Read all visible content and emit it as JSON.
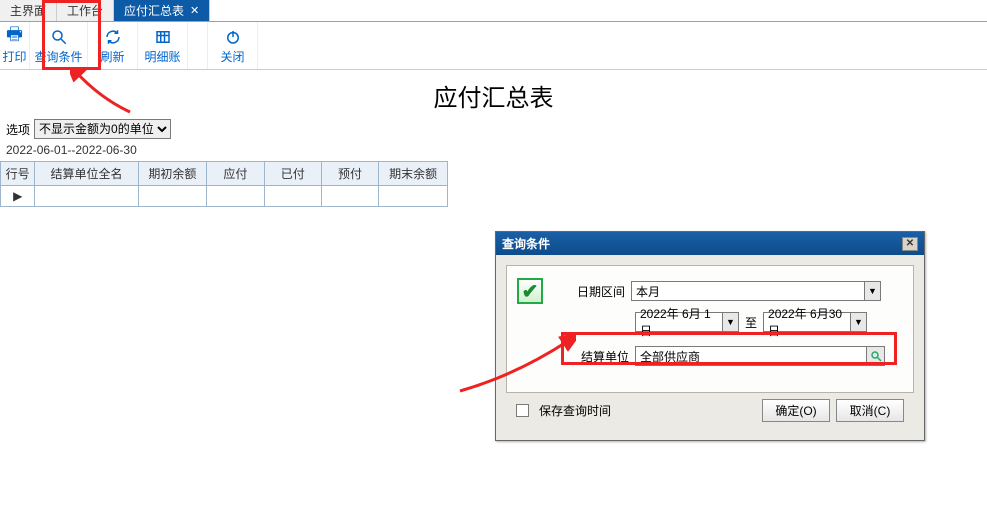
{
  "tabs": {
    "items": [
      {
        "label": "主界面"
      },
      {
        "label": "工作台"
      },
      {
        "label": "应付汇总表",
        "active": true
      }
    ]
  },
  "toolbar": {
    "print": "打印",
    "query": "查询条件",
    "refresh": "刷新",
    "detail": "明细账",
    "close": "关闭"
  },
  "page_title": "应付汇总表",
  "options": {
    "label": "选项",
    "selected": "不显示金额为0的单位"
  },
  "date_range_text": "2022-06-01--2022-06-30",
  "table": {
    "headers": [
      "行号",
      "结算单位全名",
      "期初余额",
      "应付",
      "已付",
      "预付",
      "期末余额"
    ]
  },
  "dialog": {
    "title": "查询条件",
    "date_section_label": "日期区间",
    "date_preset": "本月",
    "date_from": "2022年 6月 1日",
    "to_label": "至",
    "date_to": "2022年 6月30日",
    "unit_label": "结算单位",
    "unit_value": "全部供应商",
    "save_query_label": "保存查询时间",
    "ok_label": "确定(O)",
    "cancel_label": "取消(C)"
  }
}
